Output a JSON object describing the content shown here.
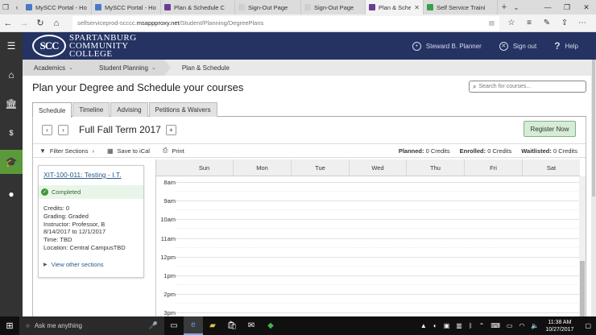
{
  "browser": {
    "tabs": [
      {
        "label": "MySCC Portal - Ho",
        "color": "#4a79c7",
        "active": false
      },
      {
        "label": "MySCC Portal - Ho",
        "color": "#4a79c7",
        "active": false
      },
      {
        "label": "Plan & Schedule C",
        "color": "#6a3d8f",
        "active": false
      },
      {
        "label": "Sign-Out Page",
        "color": "#cfcfcf",
        "active": false
      },
      {
        "label": "Sign-Out Page",
        "color": "#cfcfcf",
        "active": false
      },
      {
        "label": "Plan & Schedu",
        "color": "#6a3d8f",
        "active": true
      },
      {
        "label": "Self Service Traini",
        "color": "#3aa04a",
        "active": false
      }
    ],
    "url_prefix": "selfserviceprod-scccc.",
    "url_host": "msappproxy.net",
    "url_path": "/Student/Planning/DegreePlans"
  },
  "header": {
    "logo_seal": "SCC",
    "logo_line1": "SPARTANBURG",
    "logo_line2": "COMMUNITY",
    "logo_line3": "COLLEGE",
    "user": "Steward B. Planner",
    "signout": "Sign out",
    "help": "Help"
  },
  "breadcrumb": {
    "academics": "Academics",
    "student_planning": "Student Planning",
    "current": "Plan & Schedule"
  },
  "main": {
    "title": "Plan your Degree and Schedule your courses",
    "search_placeholder": "Search for courses...",
    "tabs": [
      "Schedule",
      "Timeline",
      "Advising",
      "Petitions & Waivers"
    ],
    "term": "Full Fall Term 2017",
    "register": "Register Now",
    "filter": "Filter Sections",
    "save_ical": "Save to iCal",
    "print": "Print",
    "planned_label": "Planned:",
    "planned_value": "0 Credits",
    "enrolled_label": "Enrolled:",
    "enrolled_value": "0 Credits",
    "waitlisted_label": "Waitlisted:",
    "waitlisted_value": "0 Credits"
  },
  "course": {
    "code": "XIT-100-011: Testing - I.T.",
    "status": "Completed",
    "credits": "Credits: 0",
    "grading": "Grading: Graded",
    "instructor": "Instructor: Professor, B",
    "dates": "8/14/2017 to 12/1/2017",
    "time": "Time: TBD",
    "location": "Location: Central CampusTBD",
    "view_sections": "View other sections"
  },
  "calendar": {
    "days": [
      "Sun",
      "Mon",
      "Tue",
      "Wed",
      "Thu",
      "Fri",
      "Sat"
    ],
    "hours": [
      "8am",
      "9am",
      "10am",
      "11am",
      "12pm",
      "1pm",
      "2pm",
      "3pm"
    ]
  },
  "taskbar": {
    "search": "Ask me anything",
    "time": "11:38 AM",
    "date": "10/27/2017"
  }
}
